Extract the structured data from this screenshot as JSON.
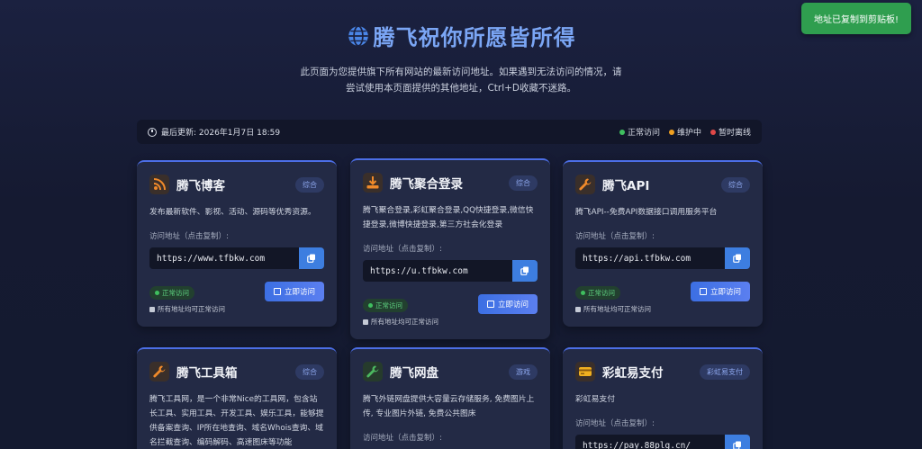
{
  "toast": "地址已复制到剪贴板!",
  "header": {
    "title": "腾飞祝你所愿皆所得",
    "subtitle": "此页面为您提供旗下所有网站的最新访问地址。如果遇到无法访问的情况，请尝试使用本页面提供的其他地址，Ctrl+D收藏不迷路。"
  },
  "statusbar": {
    "updated": "最后更新: 2026年1月7日 18:59",
    "legend": [
      {
        "label": "正常访问",
        "color": "#3fbf5f"
      },
      {
        "label": "维护中",
        "color": "#f0a020"
      },
      {
        "label": "暂时离线",
        "color": "#e04848"
      }
    ]
  },
  "common": {
    "addr_label": "访问地址（点击复制）:",
    "visit_label": "立即访问",
    "status_label": "正常访问",
    "status_note": "所有地址均可正常访问"
  },
  "cards": [
    {
      "title": "腾飞博客",
      "badge": "综合",
      "desc": "发布最新软件、影视、活动、源码等优秀资源。",
      "url": "https://www.tfbkw.com",
      "icon": "rss-icon"
    },
    {
      "title": "腾飞聚合登录",
      "badge": "综合",
      "desc": "腾飞聚合登录,彩虹聚合登录,QQ快捷登录,微信快捷登录,微博快捷登录,第三方社会化登录",
      "url": "https://u.tfbkw.com",
      "icon": "download-icon"
    },
    {
      "title": "腾飞API",
      "badge": "综合",
      "desc": "腾飞API--免费API数据接口调用服务平台",
      "url": "https://api.tfbkw.com",
      "icon": "wrench-icon"
    },
    {
      "title": "腾飞工具箱",
      "badge": "综合",
      "desc": "腾飞工具网，是一个非常Nice的工具网，包含站长工具、实用工具、开发工具、娱乐工具，能够提供备案查询、IP所在地查询、域名Whois查询、域名拦截查询、编码解码、高速图床等功能",
      "icon": "wrench-icon"
    },
    {
      "title": "腾飞网盘",
      "badge": "游戏",
      "desc": "腾飞外链网盘提供大容量云存储服务, 免费图片上传, 专业图片外链, 免费公共图床",
      "icon": "wrench-icon"
    },
    {
      "title": "彩虹易支付",
      "badge": "彩虹易支付",
      "desc": "彩虹易支付",
      "url": "https://pay.88plg.cn/",
      "icon": "card-icon"
    }
  ]
}
